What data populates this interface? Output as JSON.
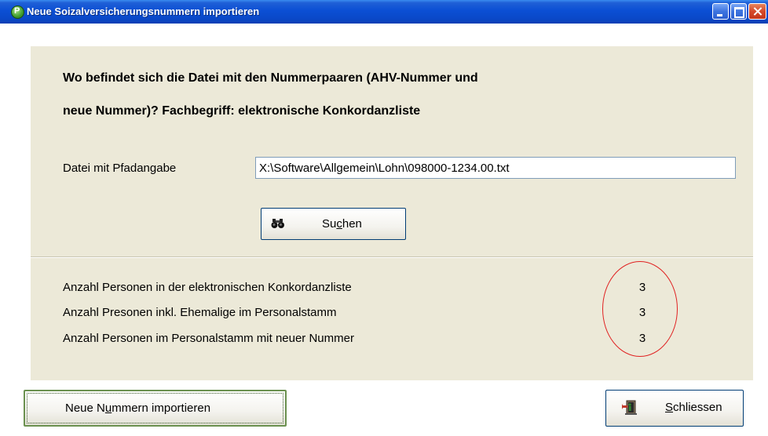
{
  "window": {
    "title": "Neue Soizalversicherungsnummern importieren"
  },
  "question": {
    "line1": "Wo befindet sich die Datei mit den Nummerpaaren (AHV-Nummer und",
    "line2": "neue Nummer)? Fachbegriff: elektronische Konkordanzliste"
  },
  "file": {
    "label": "Datei mit Pfadangabe",
    "value": "X:\\Software\\Allgemein\\Lohn\\098000-1234.00.txt"
  },
  "search_button": {
    "label_pre": "Su",
    "label_u": "c",
    "label_post": "hen",
    "icon": "binoculars-icon"
  },
  "stats": [
    {
      "label": "Anzahl Personen in der elektronischen Konkordanzliste",
      "value": "3"
    },
    {
      "label": "Anzahl Presonen inkl. Ehemalige im Personalstamm",
      "value": "3"
    },
    {
      "label": "Anzahl Personen im Personalstamm mit neuer Nummer",
      "value": "3"
    }
  ],
  "import_button": {
    "label_pre": "Neue N",
    "label_u": "u",
    "label_post": "mmern importieren"
  },
  "close_button": {
    "label_pre": "",
    "label_u": "S",
    "label_post": "chliessen",
    "icon": "exit-door-icon"
  },
  "colors": {
    "titlebar": "#0b4fd4",
    "panel": "#ece9d8",
    "highlight_circle": "#e02020"
  }
}
